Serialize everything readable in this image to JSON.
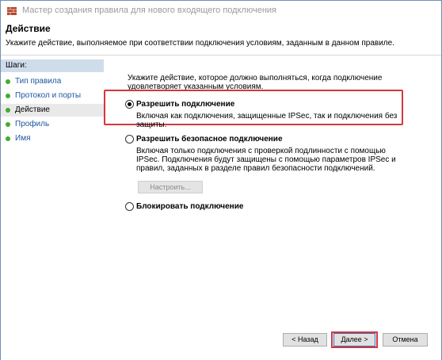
{
  "window": {
    "title": "Мастер создания правила для нового входящего подключения",
    "icon": "firewall-icon"
  },
  "header": {
    "title": "Действие",
    "subtitle": "Укажите действие, выполняемое при соответствии подключения условиям, заданным в данном правиле."
  },
  "sidebar": {
    "heading": "Шаги:",
    "steps": [
      {
        "label": "Тип правила"
      },
      {
        "label": "Протокол и порты"
      },
      {
        "label": "Действие"
      },
      {
        "label": "Профиль"
      },
      {
        "label": "Имя"
      }
    ]
  },
  "main": {
    "intro": "Укажите действие, которое должно выполняться, когда подключение удовлетворяет указанным условиям.",
    "options": [
      {
        "label": "Разрешить подключение",
        "description": "Включая как подключения, защищенные IPSec, так и подключения без защиты.",
        "checked": true
      },
      {
        "label": "Разрешить безопасное подключение",
        "description": "Включая только подключения с проверкой подлинности с помощью IPSec. Подключения будут защищены с помощью параметров IPSec и правил, заданных в разделе правил безопасности подключений.",
        "checked": false
      },
      {
        "label": "Блокировать подключение",
        "description": "",
        "checked": false
      }
    ],
    "customize_label": "Настроить..."
  },
  "footer": {
    "back_label": "< Назад",
    "next_label": "Далее >",
    "cancel_label": "Отмена"
  },
  "colors": {
    "highlight": "#d6373c",
    "step_bullet": "#3fae2a",
    "link": "#1e56a0"
  }
}
